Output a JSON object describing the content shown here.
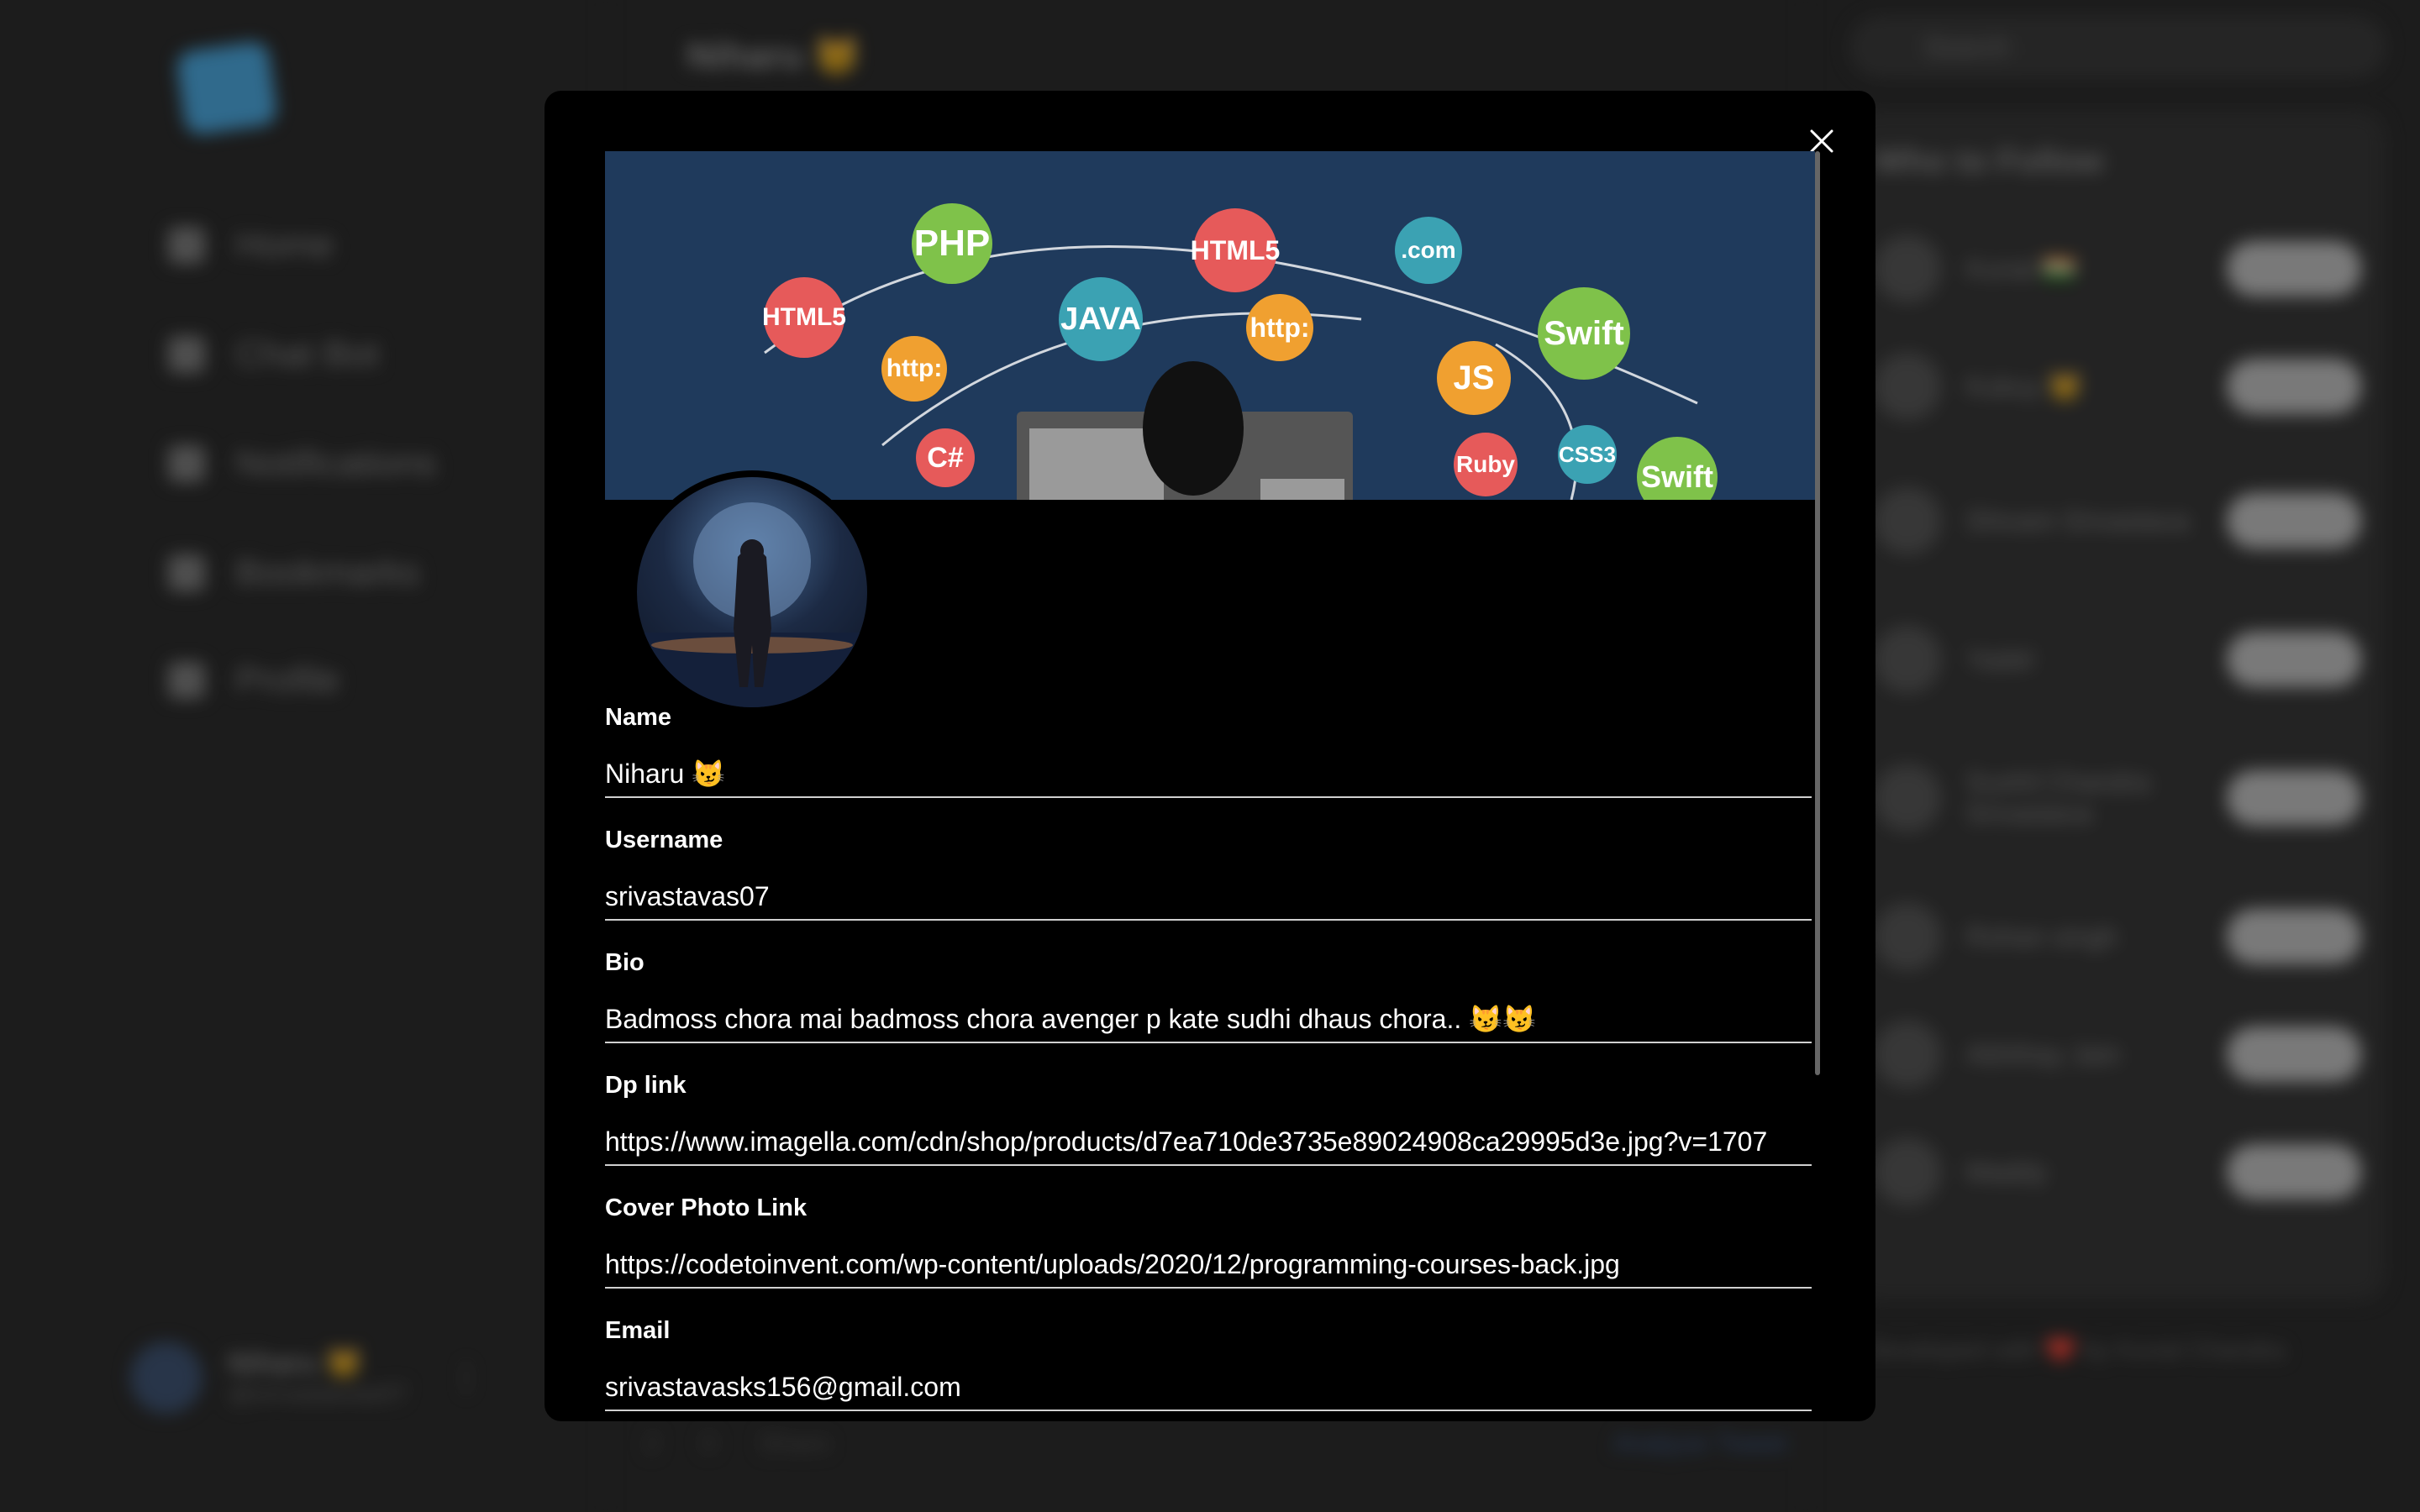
{
  "sidebar": {
    "nav": [
      {
        "label": "Home"
      },
      {
        "label": "Chat Bot"
      },
      {
        "label": "Notifications"
      },
      {
        "label": "Bookmarks"
      },
      {
        "label": "Profile"
      }
    ],
    "user": {
      "name": "Niharu 😼",
      "handle": "@srivastavas07"
    }
  },
  "feed": {
    "title": "Niharu 😼",
    "actions": [
      "2",
      "0",
      "Share",
      "Analyze Tweet"
    ]
  },
  "right": {
    "search_placeholder": "Search",
    "who_title": "Who to Follow",
    "follow_label": "Follow",
    "people": [
      {
        "name": "Kunal 🇮🇳"
      },
      {
        "name": "Kukuy 😼"
      },
      {
        "name": "Shivam Srivastava"
      },
      {
        "name": "Yadel"
      },
      {
        "name": "Sushil Chandra Srivastava"
      },
      {
        "name": "Rohan singh"
      },
      {
        "name": "Abhihay Jain"
      },
      {
        "name": "Maddy"
      }
    ],
    "footer": "Developed with ❤️ by Kunal Chandra"
  },
  "modal": {
    "close_icon": "close-icon",
    "cover_badges": [
      "PHP",
      "HTML5",
      "JAVA",
      "http:",
      ".com",
      "Swift",
      "JS",
      "HTML5",
      "http:",
      "C#",
      "Ruby",
      "CSS3",
      "Swift"
    ],
    "fields": [
      {
        "label": "Name",
        "value": "Niharu 😼"
      },
      {
        "label": "Username",
        "value": "srivastavas07"
      },
      {
        "label": "Bio",
        "value": "Badmoss chora mai badmoss chora avenger p kate sudhi dhaus chora.. 😼😼"
      },
      {
        "label": "Dp link",
        "value": "https://www.imagella.com/cdn/shop/products/d7ea710de3735e89024908ca29995d3e.jpg?v=1707"
      },
      {
        "label": "Cover Photo Link",
        "value": "https://codetoinvent.com/wp-content/uploads/2020/12/programming-courses-back.jpg"
      },
      {
        "label": "Email",
        "value": "srivastavasks156@gmail.com"
      }
    ]
  }
}
